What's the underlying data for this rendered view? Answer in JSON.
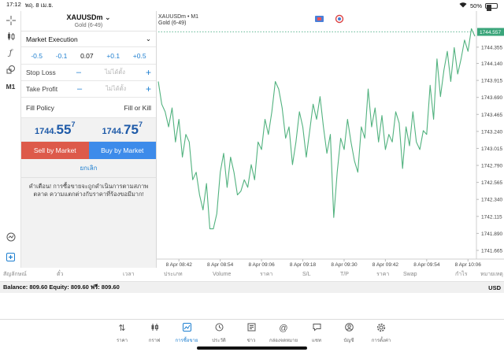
{
  "status_bar": {
    "time": "17:12",
    "date": "พฤ. 8 เม.ย.",
    "battery": "50%",
    "battery_level": 0.5
  },
  "left_tools": {
    "timeframe": "M1"
  },
  "order_panel": {
    "symbol": "XAUUSDm",
    "symbol_desc": "Gold (6-49)",
    "execution": "Market Execution",
    "volume": {
      "minus_big": "-0.5",
      "minus_small": "-0.1",
      "value": "0.07",
      "plus_small": "+0.1",
      "plus_big": "+0.5"
    },
    "stop_loss": {
      "label": "Stop Loss",
      "placeholder": "ไม่ได้ตั้ง"
    },
    "take_profit": {
      "label": "Take Profit",
      "placeholder": "ไม่ได้ตั้ง"
    },
    "fill_policy": {
      "label": "Fill Policy",
      "value": "Fill or Kill"
    },
    "bid": {
      "main": "1744.",
      "big": "55",
      "sup": "7"
    },
    "ask": {
      "main": "1744.",
      "big": "75",
      "sup": "7"
    },
    "sell_label": "Sell by Market",
    "buy_label": "Buy by Market",
    "cancel_label": "ยกเลิก",
    "warning": "คำเตือน! การซื้อขายจะถูกดำเนินการตามสภาพตลาด ความแตกต่างกับราคาที่ร้องขอมีมาก!"
  },
  "chart_data": {
    "type": "line",
    "title": "XAUUSDm • M1",
    "subtitle": "Gold (6-49)",
    "current_price": "1744.557",
    "current_value": 1744.557,
    "ylim": [
      1741.55,
      1744.75
    ],
    "y_ticks": [
      "1744.355",
      "1744.140",
      "1743.915",
      "1743.690",
      "1743.465",
      "1743.240",
      "1743.015",
      "1742.790",
      "1742.565",
      "1742.340",
      "1742.115",
      "1741.890",
      "1741.665"
    ],
    "y_tick_values": [
      1744.355,
      1744.14,
      1743.915,
      1743.69,
      1743.465,
      1743.24,
      1743.015,
      1742.79,
      1742.565,
      1742.34,
      1742.115,
      1741.89,
      1741.665
    ],
    "x_ticks": [
      "8 Apr 08:42",
      "8 Apr 08:54",
      "8 Apr 09:06",
      "8 Apr 09:18",
      "8 Apr 09:30",
      "8 Apr 09:42",
      "8 Apr 09:54",
      "8 Apr 10:06"
    ],
    "x_tick_index": [
      6,
      18,
      30,
      42,
      54,
      66,
      78,
      90
    ],
    "line_color": "#52b27f",
    "price_tag_color": "#3aa57a",
    "series": [
      {
        "values": [
          1743.9,
          1743.6,
          1743.5,
          1743.3,
          1743.55,
          1743.1,
          1743.4,
          1742.9,
          1743.2,
          1743.1,
          1742.6,
          1742.7,
          1742.4,
          1742.2,
          1742.55,
          1741.95,
          1741.95,
          1742.15,
          1742.7,
          1742.95,
          1742.5,
          1742.9,
          1742.7,
          1742.4,
          1742.45,
          1742.6,
          1742.5,
          1742.8,
          1742.6,
          1743.1,
          1743.0,
          1743.4,
          1743.2,
          1743.5,
          1743.9,
          1743.8,
          1743.55,
          1743.15,
          1743.3,
          1742.8,
          1743.1,
          1743.5,
          1743.3,
          1742.9,
          1743.25,
          1743.6,
          1743.4,
          1743.7,
          1743.3,
          1742.95,
          1743.2,
          1742.1,
          1742.7,
          1743.15,
          1743.0,
          1743.4,
          1743.1,
          1742.85,
          1742.7,
          1743.3,
          1743.15,
          1743.8,
          1743.3,
          1743.55,
          1743.1,
          1743.45,
          1743.0,
          1743.2,
          1743.1,
          1743.5,
          1743.35,
          1742.75,
          1743.3,
          1743.05,
          1743.5,
          1743.1,
          1743.0,
          1743.25,
          1743.2,
          1743.85,
          1743.4,
          1744.2,
          1743.7,
          1744.05,
          1744.3,
          1743.9,
          1744.35,
          1744.0,
          1744.2,
          1744.45,
          1744.3,
          1744.6,
          1744.5
        ]
      }
    ]
  },
  "columns": [
    "สัญลักษณ์",
    "ตั๋ว",
    "เวลา",
    "ประเภท",
    "Volume",
    "ราคา",
    "S/L",
    "T/P",
    "ราคา",
    "Swap",
    "กำไร",
    "หมายเหตุ"
  ],
  "balance": {
    "text": "Balance: 809.60 Equity: 809.60 ฟรี: 809.60",
    "currency": "USD"
  },
  "tabs": [
    {
      "label": "ราคา",
      "icon": "quotes-icon"
    },
    {
      "label": "กราฟ",
      "icon": "chart-icon"
    },
    {
      "label": "การซื้อขาย",
      "icon": "trade-icon",
      "active": true
    },
    {
      "label": "ประวัติ",
      "icon": "history-icon"
    },
    {
      "label": "ข่าว",
      "icon": "news-icon"
    },
    {
      "label": "กล่องจดหมาย",
      "icon": "mailbox-icon"
    },
    {
      "label": "แชท",
      "icon": "chat-icon"
    },
    {
      "label": "บัญชี",
      "icon": "account-icon"
    },
    {
      "label": "การตั้งค่า",
      "icon": "settings-icon"
    }
  ]
}
